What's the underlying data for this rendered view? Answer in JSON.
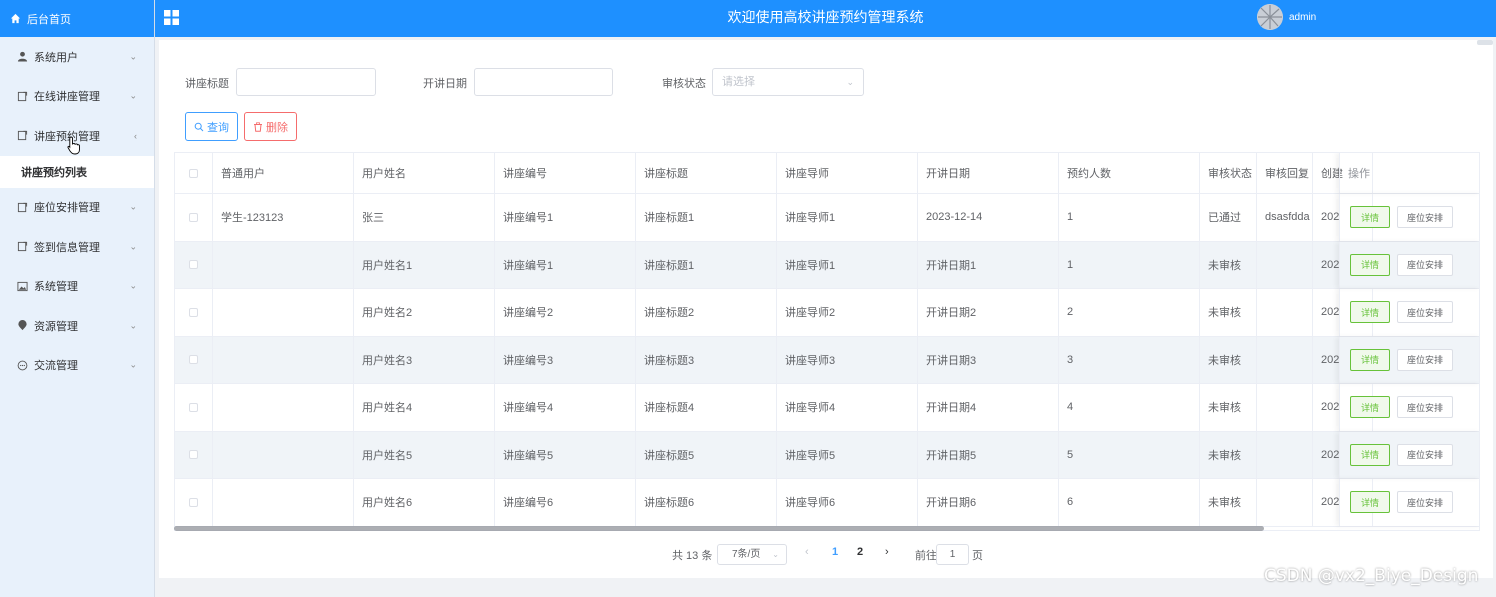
{
  "sidebar": {
    "home_label": "后台首页",
    "items": [
      {
        "label": "系统用户",
        "icon": "user-icon"
      },
      {
        "label": "在线讲座管理",
        "icon": "doc-icon"
      },
      {
        "label": "讲座预约管理",
        "icon": "doc-icon"
      },
      {
        "label": "座位安排管理",
        "icon": "doc-icon"
      },
      {
        "label": "签到信息管理",
        "icon": "doc-icon"
      },
      {
        "label": "系统管理",
        "icon": "picture-icon"
      },
      {
        "label": "资源管理",
        "icon": "location-icon"
      },
      {
        "label": "交流管理",
        "icon": "chat-icon"
      }
    ],
    "subitem_label": "讲座预约列表"
  },
  "header": {
    "title": "欢迎使用高校讲座预约管理系统",
    "user": "admin"
  },
  "filters": {
    "title_label": "讲座标题",
    "date_label": "开讲日期",
    "status_label": "审核状态",
    "status_placeholder": "请选择"
  },
  "buttons": {
    "query": "查询",
    "delete": "删除"
  },
  "table": {
    "columns": [
      "普通用户",
      "用户姓名",
      "讲座编号",
      "讲座标题",
      "讲座导师",
      "开讲日期",
      "预约人数",
      "审核状态",
      "审核回复",
      "创建"
    ],
    "ops_header": "操作",
    "detail_label": "详情",
    "seat_label": "座位安排",
    "rows": [
      [
        "学生-123123",
        "张三",
        "讲座编号1",
        "讲座标题1",
        "讲座导师1",
        "2023-12-14",
        "1",
        "已通过",
        "dsasfdda",
        "202"
      ],
      [
        "",
        "用户姓名1",
        "讲座编号1",
        "讲座标题1",
        "讲座导师1",
        "开讲日期1",
        "1",
        "未审核",
        "",
        "202"
      ],
      [
        "",
        "用户姓名2",
        "讲座编号2",
        "讲座标题2",
        "讲座导师2",
        "开讲日期2",
        "2",
        "未审核",
        "",
        "202"
      ],
      [
        "",
        "用户姓名3",
        "讲座编号3",
        "讲座标题3",
        "讲座导师3",
        "开讲日期3",
        "3",
        "未审核",
        "",
        "202"
      ],
      [
        "",
        "用户姓名4",
        "讲座编号4",
        "讲座标题4",
        "讲座导师4",
        "开讲日期4",
        "4",
        "未审核",
        "",
        "202"
      ],
      [
        "",
        "用户姓名5",
        "讲座编号5",
        "讲座标题5",
        "讲座导师5",
        "开讲日期5",
        "5",
        "未审核",
        "",
        "202"
      ],
      [
        "",
        "用户姓名6",
        "讲座编号6",
        "讲座标题6",
        "讲座导师6",
        "开讲日期6",
        "6",
        "未审核",
        "",
        "202"
      ]
    ]
  },
  "pagination": {
    "total": "共 13 条",
    "page_size": "7条/页",
    "pages": [
      "1",
      "2"
    ],
    "goto_prefix": "前往",
    "goto_value": "1",
    "goto_suffix": "页"
  },
  "watermark": "CSDN @vx2_Biye_Design",
  "colors": {
    "primary": "#1e90ff",
    "link": "#409eff",
    "danger": "#f56c6c",
    "success": "#67c23a"
  }
}
